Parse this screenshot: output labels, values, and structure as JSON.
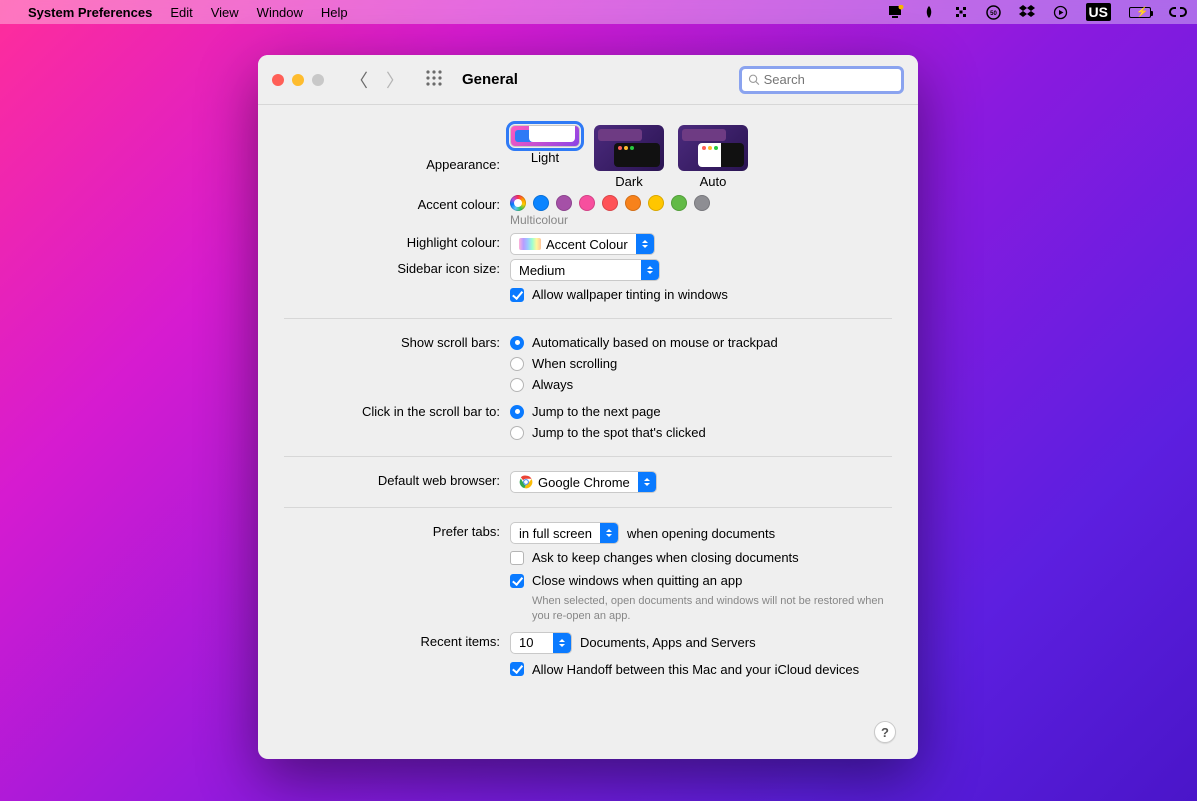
{
  "menubar": {
    "app_name": "System Preferences",
    "items": [
      "Edit",
      "View",
      "Window",
      "Help"
    ],
    "status_region": "US"
  },
  "window": {
    "title": "General",
    "search_placeholder": "Search"
  },
  "appearance": {
    "label": "Appearance:",
    "options": [
      "Light",
      "Dark",
      "Auto"
    ],
    "selected": "Light"
  },
  "accent": {
    "label": "Accent colour:",
    "selected_name": "Multicolour"
  },
  "highlight": {
    "label": "Highlight colour:",
    "value": "Accent Colour"
  },
  "sidebar_icon": {
    "label": "Sidebar icon size:",
    "value": "Medium"
  },
  "wallpaper_tint": {
    "label": "Allow wallpaper tinting in windows",
    "checked": true
  },
  "scroll_bars": {
    "label": "Show scroll bars:",
    "options": [
      "Automatically based on mouse or trackpad",
      "When scrolling",
      "Always"
    ],
    "selected_index": 0
  },
  "scroll_click": {
    "label": "Click in the scroll bar to:",
    "options": [
      "Jump to the next page",
      "Jump to the spot that's clicked"
    ],
    "selected_index": 0
  },
  "browser": {
    "label": "Default web browser:",
    "value": "Google Chrome"
  },
  "tabs": {
    "label": "Prefer tabs:",
    "value": "in full screen",
    "suffix": "when opening documents"
  },
  "ask_keep": {
    "label": "Ask to keep changes when closing documents",
    "checked": false
  },
  "close_windows": {
    "label": "Close windows when quitting an app",
    "checked": true,
    "note": "When selected, open documents and windows will not be restored when you re-open an app."
  },
  "recent": {
    "label": "Recent items:",
    "value": "10",
    "suffix": "Documents, Apps and Servers"
  },
  "handoff": {
    "label": "Allow Handoff between this Mac and your iCloud devices",
    "checked": true
  },
  "help": "?"
}
